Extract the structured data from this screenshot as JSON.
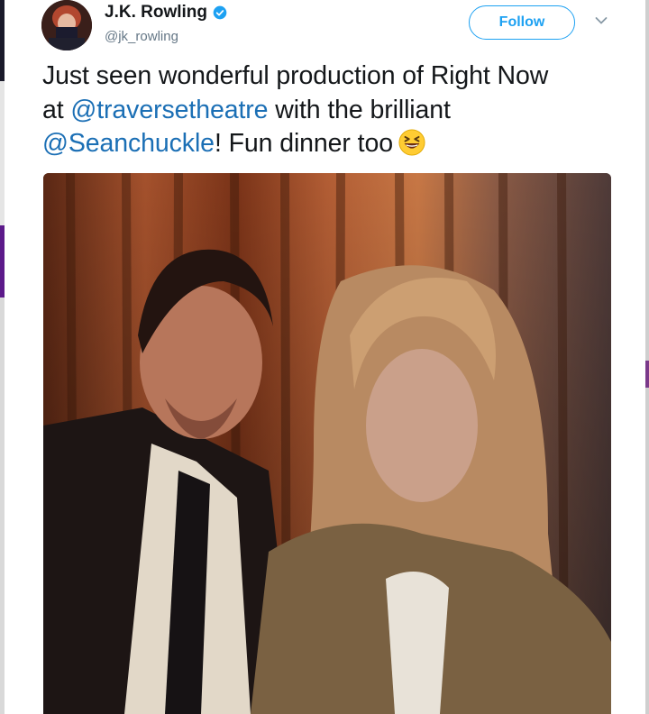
{
  "tweet": {
    "display_name": "J.K. Rowling",
    "handle": "@jk_rowling",
    "verified": true,
    "follow_label": "Follow",
    "text": {
      "line1": "Just seen wonderful production of Right Now",
      "line2_prefix": "at ",
      "mention1": "@traversetheatre",
      "line2_suffix": " with the brilliant",
      "mention2": "@Seanchuckle",
      "line3_suffix": "! Fun dinner too"
    },
    "emoji": "grinning-squinting-face-icon"
  },
  "colors": {
    "accent": "#1da1f2",
    "mention": "#1b6fb5",
    "text": "#14171a",
    "muted": "#657786"
  }
}
